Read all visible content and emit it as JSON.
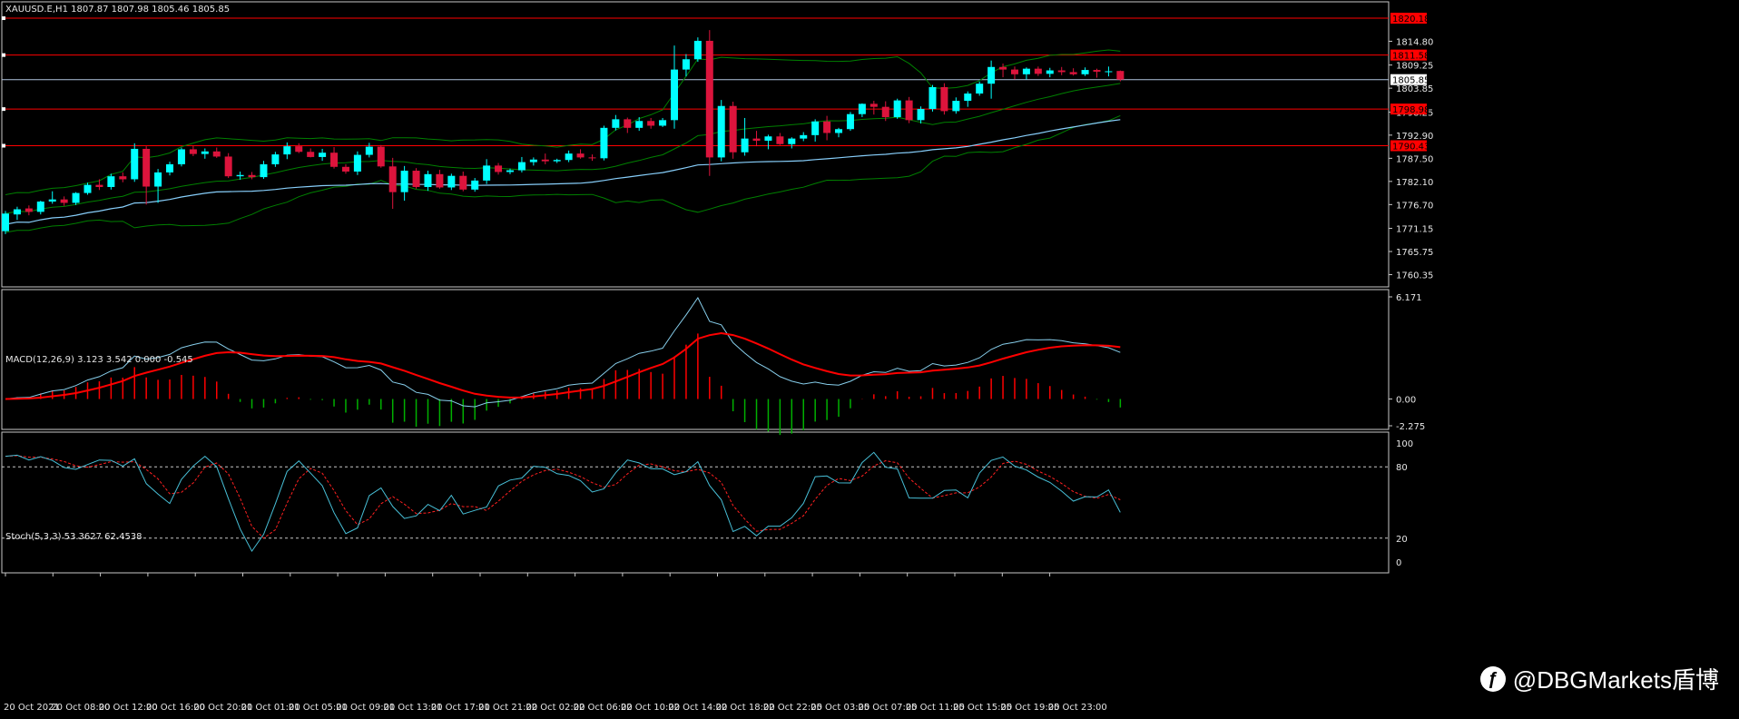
{
  "chart_data": [
    {
      "type": "candlestick",
      "title": "XAUUSD.E,H1  1807.87 1807.98 1805.46 1805.85",
      "ylim": [
        1757.5,
        1824
      ],
      "y_ticks": [
        "1814.80",
        "1809.25",
        "1803.85",
        "1798.25",
        "1792.90",
        "1787.50",
        "1782.10",
        "1776.70",
        "1771.15",
        "1765.75",
        "1760.35"
      ],
      "current_price": "1805.85",
      "levels": [
        {
          "label": "1820.18",
          "value": 1820.18
        },
        {
          "label": "1811.58",
          "value": 1811.58
        },
        {
          "label": "1798.98",
          "value": 1798.98
        },
        {
          "label": "1790.43",
          "value": 1790.43
        }
      ],
      "ohlc": [
        [
          1770.5,
          1775.2,
          1769.8,
          1774.6
        ],
        [
          1774.4,
          1776.2,
          1773.1,
          1775.6
        ],
        [
          1775.8,
          1776.5,
          1774.2,
          1775.0
        ],
        [
          1775.0,
          1777.6,
          1774.4,
          1777.4
        ],
        [
          1777.4,
          1779.8,
          1776.9,
          1777.9
        ],
        [
          1777.9,
          1778.6,
          1776.4,
          1777.1
        ],
        [
          1777.1,
          1779.6,
          1776.6,
          1779.4
        ],
        [
          1779.4,
          1781.8,
          1779.0,
          1781.3
        ],
        [
          1781.3,
          1782.6,
          1780.1,
          1780.8
        ],
        [
          1780.8,
          1783.9,
          1780.2,
          1783.3
        ],
        [
          1783.3,
          1784.2,
          1781.9,
          1782.6
        ],
        [
          1782.6,
          1791.0,
          1782.0,
          1789.7
        ],
        [
          1789.7,
          1790.3,
          1776.7,
          1780.9
        ],
        [
          1780.9,
          1785.0,
          1777.1,
          1784.2
        ],
        [
          1784.2,
          1786.7,
          1783.5,
          1786.1
        ],
        [
          1786.1,
          1790.0,
          1785.6,
          1789.6
        ],
        [
          1789.6,
          1790.4,
          1788.0,
          1788.5
        ],
        [
          1788.5,
          1789.8,
          1787.4,
          1789.1
        ],
        [
          1789.1,
          1790.0,
          1787.6,
          1787.9
        ],
        [
          1787.9,
          1788.7,
          1782.9,
          1783.3
        ],
        [
          1783.3,
          1784.4,
          1782.5,
          1783.6
        ],
        [
          1783.6,
          1784.3,
          1782.6,
          1783.1
        ],
        [
          1783.1,
          1786.9,
          1782.7,
          1786.1
        ],
        [
          1786.1,
          1789.0,
          1785.5,
          1788.4
        ],
        [
          1788.4,
          1791.2,
          1787.3,
          1790.3
        ],
        [
          1790.3,
          1791.0,
          1788.7,
          1789.0
        ],
        [
          1789.0,
          1789.8,
          1787.7,
          1787.8
        ],
        [
          1787.8,
          1789.7,
          1786.9,
          1788.8
        ],
        [
          1788.8,
          1790.1,
          1785.1,
          1785.5
        ],
        [
          1785.5,
          1786.1,
          1783.9,
          1784.4
        ],
        [
          1784.4,
          1789.1,
          1783.6,
          1788.3
        ],
        [
          1788.3,
          1791.1,
          1787.7,
          1790.2
        ],
        [
          1790.2,
          1790.6,
          1785.3,
          1785.6
        ],
        [
          1785.6,
          1787.6,
          1775.7,
          1779.6
        ],
        [
          1779.6,
          1785.7,
          1777.6,
          1784.6
        ],
        [
          1784.6,
          1785.2,
          1780.4,
          1780.8
        ],
        [
          1780.8,
          1784.6,
          1779.9,
          1783.8
        ],
        [
          1783.8,
          1784.8,
          1780.4,
          1780.7
        ],
        [
          1780.7,
          1783.9,
          1780.1,
          1783.4
        ],
        [
          1783.4,
          1784.4,
          1779.8,
          1780.2
        ],
        [
          1780.2,
          1782.9,
          1779.7,
          1782.3
        ],
        [
          1782.3,
          1787.3,
          1781.5,
          1785.8
        ],
        [
          1785.8,
          1786.4,
          1783.7,
          1784.3
        ],
        [
          1784.3,
          1785.1,
          1783.8,
          1784.7
        ],
        [
          1784.7,
          1787.8,
          1784.2,
          1786.6
        ],
        [
          1786.6,
          1787.7,
          1785.8,
          1787.2
        ],
        [
          1787.2,
          1788.6,
          1786.1,
          1786.8
        ],
        [
          1786.8,
          1787.4,
          1786.4,
          1787.1
        ],
        [
          1787.1,
          1789.3,
          1786.6,
          1788.6
        ],
        [
          1788.6,
          1789.6,
          1787.4,
          1787.7
        ],
        [
          1787.7,
          1788.4,
          1786.9,
          1787.5
        ],
        [
          1787.5,
          1795.1,
          1787.0,
          1794.6
        ],
        [
          1794.6,
          1797.6,
          1794.0,
          1796.6
        ],
        [
          1796.6,
          1797.0,
          1793.4,
          1794.6
        ],
        [
          1794.6,
          1797.1,
          1793.9,
          1796.2
        ],
        [
          1796.2,
          1796.9,
          1794.4,
          1795.1
        ],
        [
          1795.1,
          1796.9,
          1794.8,
          1796.4
        ],
        [
          1796.4,
          1813.8,
          1794.4,
          1808.2
        ],
        [
          1808.2,
          1811.8,
          1806.6,
          1810.6
        ],
        [
          1810.6,
          1815.7,
          1810.0,
          1814.9
        ],
        [
          1814.9,
          1817.4,
          1783.4,
          1787.7
        ],
        [
          1787.7,
          1801.1,
          1786.8,
          1799.7
        ],
        [
          1799.7,
          1800.7,
          1787.4,
          1788.9
        ],
        [
          1788.9,
          1796.9,
          1788.1,
          1792.1
        ],
        [
          1792.1,
          1793.9,
          1790.3,
          1791.6
        ],
        [
          1791.6,
          1793.0,
          1789.6,
          1792.6
        ],
        [
          1792.6,
          1793.4,
          1790.6,
          1790.8
        ],
        [
          1790.8,
          1792.4,
          1789.8,
          1792.1
        ],
        [
          1792.1,
          1793.6,
          1791.5,
          1792.9
        ],
        [
          1792.9,
          1796.6,
          1791.4,
          1796.1
        ],
        [
          1796.1,
          1797.4,
          1791.7,
          1793.4
        ],
        [
          1793.4,
          1794.6,
          1792.4,
          1794.3
        ],
        [
          1794.3,
          1798.3,
          1793.9,
          1797.8
        ],
        [
          1797.8,
          1800.3,
          1797.1,
          1800.2
        ],
        [
          1800.2,
          1800.9,
          1797.7,
          1799.5
        ],
        [
          1799.5,
          1800.8,
          1796.2,
          1797.1
        ],
        [
          1797.1,
          1801.4,
          1796.7,
          1801.0
        ],
        [
          1801.0,
          1801.8,
          1795.7,
          1796.4
        ],
        [
          1796.4,
          1799.6,
          1795.6,
          1799.0
        ],
        [
          1799.0,
          1804.6,
          1798.4,
          1804.1
        ],
        [
          1804.1,
          1805.0,
          1797.7,
          1798.5
        ],
        [
          1798.5,
          1801.7,
          1797.9,
          1800.9
        ],
        [
          1800.9,
          1803.1,
          1799.5,
          1802.6
        ],
        [
          1802.6,
          1805.4,
          1802.1,
          1804.9
        ],
        [
          1804.9,
          1810.3,
          1801.4,
          1808.8
        ],
        [
          1808.8,
          1809.6,
          1806.4,
          1808.2
        ],
        [
          1808.2,
          1808.9,
          1805.9,
          1807.1
        ],
        [
          1807.1,
          1808.7,
          1805.9,
          1808.4
        ],
        [
          1808.4,
          1808.9,
          1806.7,
          1807.2
        ],
        [
          1807.2,
          1808.6,
          1806.4,
          1808.0
        ],
        [
          1808.0,
          1808.8,
          1806.9,
          1807.6
        ],
        [
          1807.6,
          1808.5,
          1806.8,
          1807.1
        ],
        [
          1807.1,
          1808.7,
          1806.7,
          1808.1
        ],
        [
          1808.1,
          1808.4,
          1806.3,
          1807.7
        ],
        [
          1807.7,
          1808.9,
          1806.6,
          1807.8
        ],
        [
          1807.87,
          1807.98,
          1805.46,
          1805.85
        ]
      ]
    },
    {
      "type": "macd",
      "title": "MACD(12,26,9) 3.123 3.542 0.000 -0.545",
      "ylim": [
        -2.275,
        6.171
      ],
      "y_ticks": [
        "6.171",
        "0.00",
        "-2.275"
      ]
    },
    {
      "type": "stochastic",
      "title": "Stoch(5,3,3) 53.3627 62.4538",
      "ylim": [
        0,
        100
      ],
      "y_ticks": [
        "100",
        "80",
        "20",
        "0"
      ],
      "levels": [
        80,
        20
      ]
    }
  ],
  "x_axis": {
    "labels": [
      "20 Oct 2021",
      "20 Oct 08:00",
      "20 Oct 12:00",
      "20 Oct 16:00",
      "20 Oct 20:00",
      "21 Oct 01:00",
      "21 Oct 05:00",
      "21 Oct 09:00",
      "21 Oct 13:00",
      "21 Oct 17:00",
      "21 Oct 21:00",
      "22 Oct 02:00",
      "22 Oct 06:00",
      "22 Oct 10:00",
      "22 Oct 14:00",
      "22 Oct 18:00",
      "22 Oct 22:00",
      "25 Oct 03:00",
      "25 Oct 07:00",
      "25 Oct 11:00",
      "25 Oct 15:00",
      "25 Oct 19:00",
      "25 Oct 23:00"
    ]
  },
  "colors": {
    "bull": "#00ffff",
    "bear": "#dc143c",
    "bands": "#008000",
    "ma": "#87cefa",
    "hline": "#ff0000",
    "macd_line": "#87ceeb",
    "macd_signal": "#ff0000",
    "hist_pos": "#ff0000",
    "hist_neg": "#00b000",
    "stoch_k": "#48c0d8",
    "stoch_d": "#ff2020"
  },
  "watermark": {
    "icon": "微博",
    "text": "@DBGMarkets盾博"
  }
}
